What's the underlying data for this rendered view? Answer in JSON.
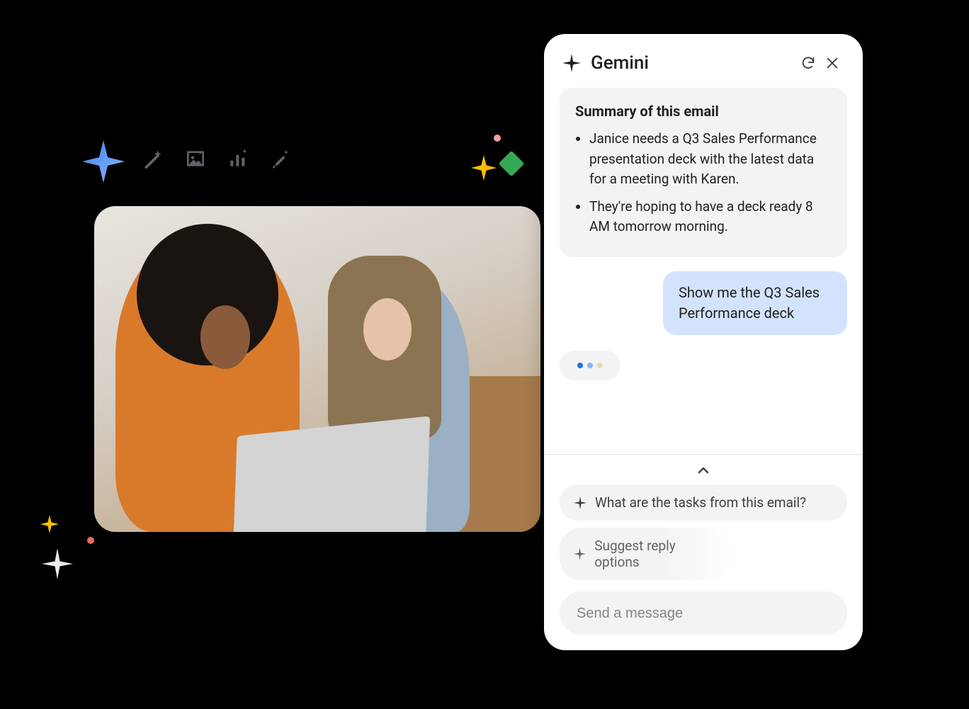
{
  "panel": {
    "title": "Gemini"
  },
  "summary": {
    "heading": "Summary of this email",
    "bullets": [
      "Janice needs a Q3 Sales Performance presentation deck with the latest data for a meeting with Karen.",
      "They're hoping to have a deck ready 8 AM tomorrow morning."
    ]
  },
  "user_message": "Show me the Q3 Sales Performance deck",
  "suggestions": [
    "What are the tasks from this email?",
    "Suggest reply options"
  ],
  "composer": {
    "placeholder": "Send a message"
  },
  "icons": {
    "refresh": "refresh-icon",
    "close": "close-icon",
    "sparkle": "sparkle-icon",
    "chevron_up": "chevron-up-icon"
  }
}
